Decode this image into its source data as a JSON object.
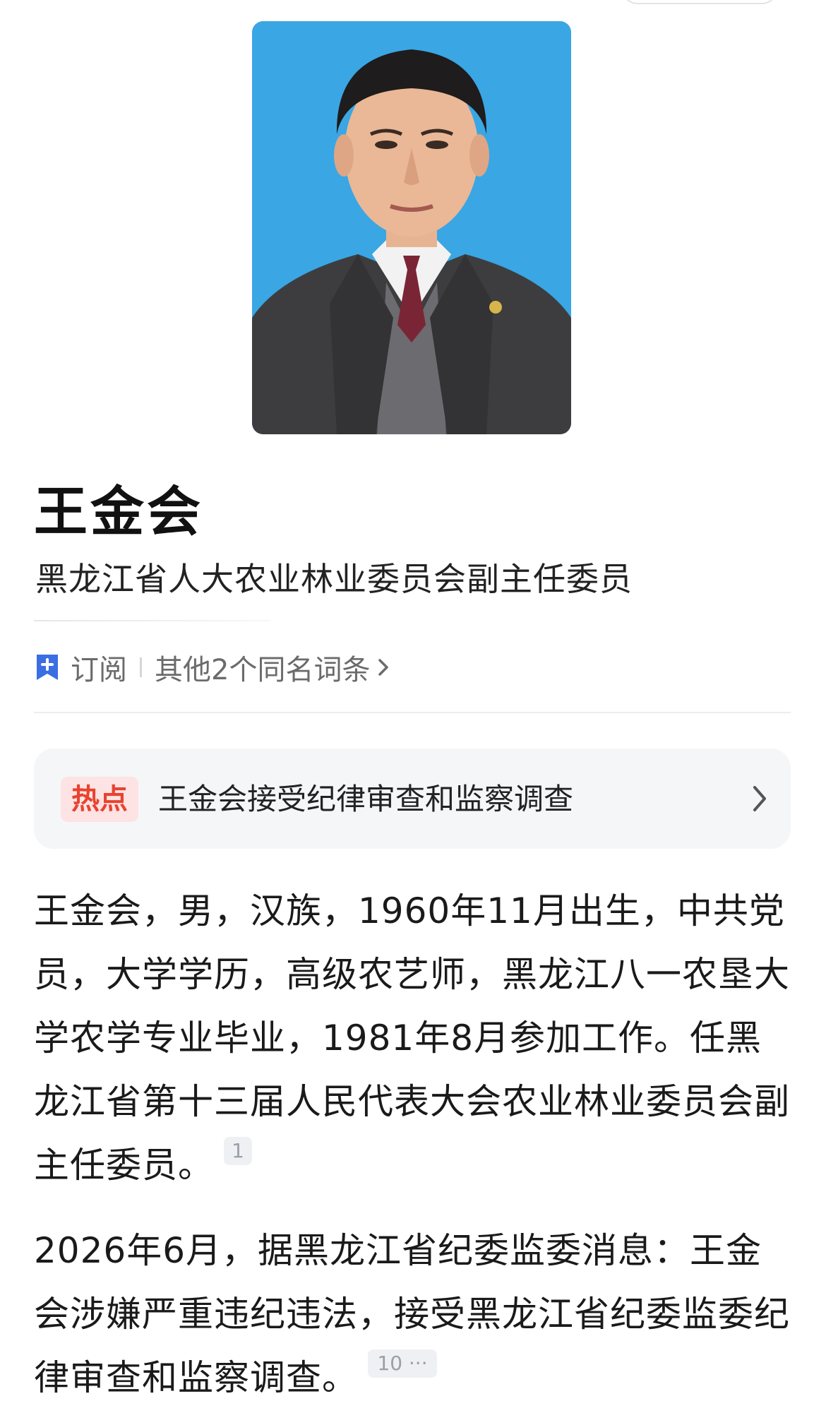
{
  "person": {
    "name": "王金会",
    "title": "黑龙江省人大农业林业委员会副主任委员"
  },
  "actions": {
    "subscribe_label": "订阅",
    "other_entries_label": "其他2个同名词条"
  },
  "hot_topic": {
    "badge": "热点",
    "text": "王金会接受纪律审查和监察调查"
  },
  "paragraphs": [
    {
      "text": "王金会，男，汉族，1960年11月出生，中共党员，大学学历，高级农艺师，黑龙江八一农垦大学农学专业毕业，1981年8月参加工作。任黑龙江省第十三届人民代表大会农业林业委员会副主任委员。",
      "citation": "1"
    },
    {
      "text": "2026年6月，据黑龙江省纪委监委消息：王金会涉嫌严重违纪违法，接受黑龙江省纪委监委纪律审查和监察调查。",
      "citation": "10 ···"
    }
  ],
  "colors": {
    "portrait_background": "#38a8e6",
    "hot_badge_text": "#e8432f",
    "hot_badge_bg": "#fde3e3",
    "bookmark_icon": "#3b6de3"
  },
  "icons": [
    "bookmark-icon",
    "chevron-right-icon"
  ]
}
